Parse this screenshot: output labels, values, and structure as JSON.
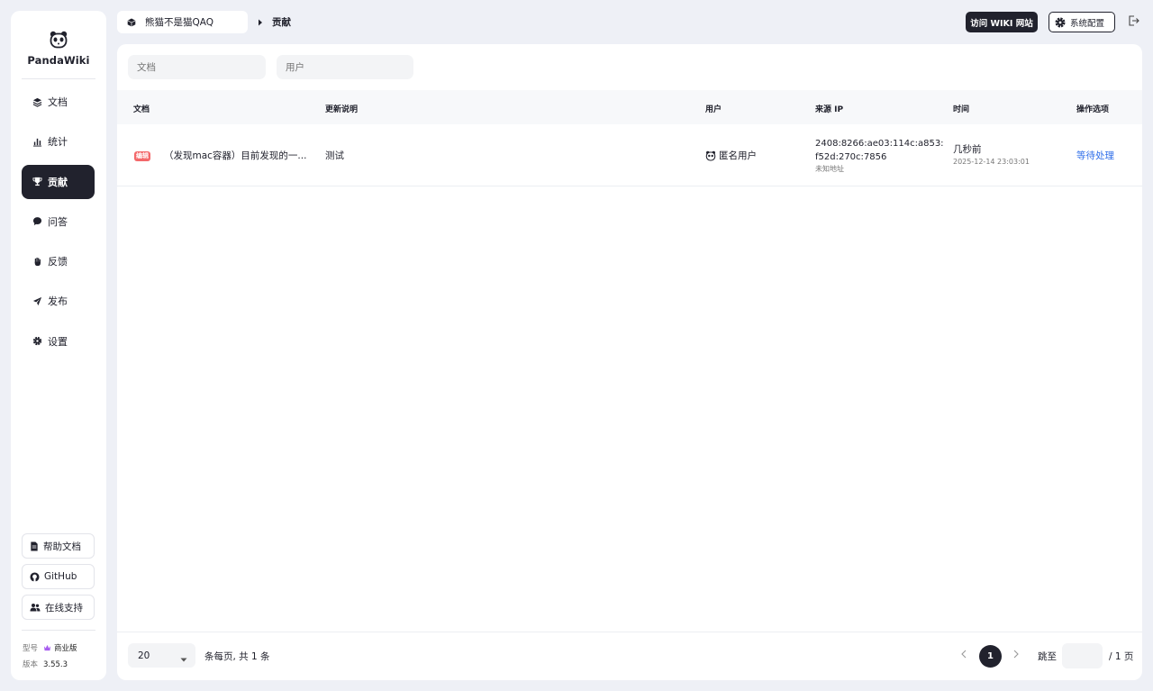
{
  "app": {
    "name": "PandaWiki"
  },
  "sidebar": {
    "items": [
      {
        "label": "文档",
        "icon": "layers-icon"
      },
      {
        "label": "统计",
        "icon": "bar-chart-icon"
      },
      {
        "label": "贡献",
        "icon": "trophy-icon",
        "active": true
      },
      {
        "label": "问答",
        "icon": "chat-bubble-icon"
      },
      {
        "label": "反馈",
        "icon": "hand-icon"
      },
      {
        "label": "发布",
        "icon": "send-icon"
      },
      {
        "label": "设置",
        "icon": "gear-icon"
      }
    ],
    "buttons": [
      {
        "label": "帮助文档",
        "icon": "document-icon"
      },
      {
        "label": "GitHub",
        "icon": "github-icon"
      },
      {
        "label": "在线支持",
        "icon": "group-icon"
      }
    ],
    "edition_label": "型号",
    "edition": "商业版",
    "version_label": "版本",
    "version": "3.55.3"
  },
  "header": {
    "wiki_name": "熊猫不是猫QAQ",
    "current": "贡献",
    "visit_button": "访问 WIKI 网站",
    "config_button": "系统配置"
  },
  "filters": {
    "doc_placeholder": "文档",
    "user_placeholder": "用户"
  },
  "table": {
    "headers": [
      "文档",
      "更新说明",
      "用户",
      "来源 IP",
      "时间",
      "操作选项"
    ],
    "rows": [
      {
        "tag": "编辑",
        "doc": "（发现mac容器）目前发现的一...",
        "remark": "测试",
        "user": "匿名用户",
        "ip_line1": "2408:8266:ae03:114c:a853:",
        "ip_line2": "f52d:270c:7856",
        "ip_location": "未知地址",
        "time_relative": "几秒前",
        "time_exact": "2025-12-14 23:03:01",
        "action": "等待处理"
      }
    ]
  },
  "pagination": {
    "page_size": "20",
    "info": "条每页, 共 1 条",
    "current_page": "1",
    "jump_label": "跳至",
    "total_pages": "/ 1 页"
  },
  "colors": {
    "accent": "#21222d",
    "link": "#2f6ee9",
    "tag": "#f3686a"
  }
}
